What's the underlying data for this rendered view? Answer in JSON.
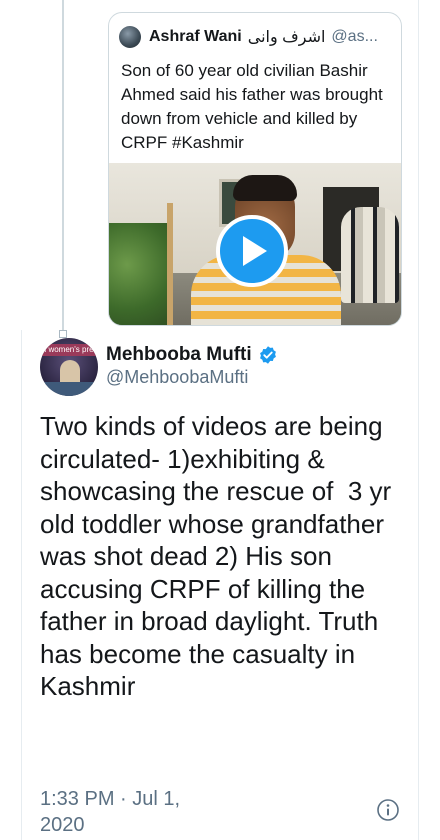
{
  "quoted_tweet": {
    "author_name": "Ashraf Wani",
    "author_name_urdu": "اشرف وانی",
    "handle": "@as...",
    "text": "Son of 60 year old civilian Bashir Ahmed said his father was brought down from vehicle and killed by CRPF #Kashmir",
    "video": {
      "play_icon": "play-icon"
    }
  },
  "tweet": {
    "avatar_banner_text": "in women's press",
    "author_name": "Mehbooba Mufti",
    "verified_icon": "verified-badge-icon",
    "handle": "@MehboobaMufti",
    "text": "Two kinds of videos are being circulated- 1)exhibiting & showcasing the rescue of  3 yr old toddler whose grandfather was shot dead 2) His son accusing CRPF of killing the father in broad daylight. Truth has become the casualty in Kashmir",
    "timestamp": "1:33 PM · Jul 1, 2020",
    "info_icon": "info-icon"
  },
  "colors": {
    "accent": "#1d9bf0",
    "secondary_text": "#5b7083",
    "border": "#cfd9de"
  }
}
